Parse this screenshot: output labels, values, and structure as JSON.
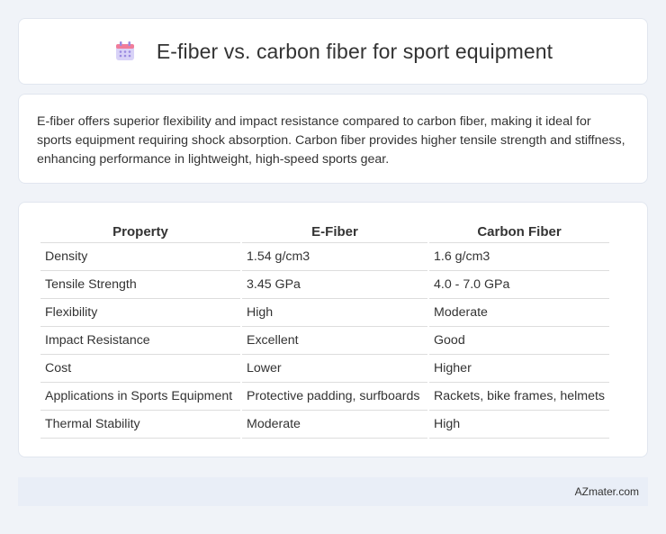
{
  "header": {
    "title": "E-fiber vs. carbon fiber for sport equipment",
    "icon": "calendar-icon",
    "icon_colors": {
      "top": "#f07c9a",
      "body": "#d8d2f7",
      "dots": "#9a8ae0"
    }
  },
  "summary": {
    "text": "E-fiber offers superior flexibility and impact resistance compared to carbon fiber, making it ideal for sports equipment requiring shock absorption. Carbon fiber provides higher tensile strength and stiffness, enhancing performance in lightweight, high-speed sports gear."
  },
  "table": {
    "headers": [
      "Property",
      "E-Fiber",
      "Carbon Fiber"
    ],
    "rows": [
      [
        "Density",
        "1.54 g/cm3",
        "1.6 g/cm3"
      ],
      [
        "Tensile Strength",
        "3.45 GPa",
        "4.0 - 7.0 GPa"
      ],
      [
        "Flexibility",
        "High",
        "Moderate"
      ],
      [
        "Impact Resistance",
        "Excellent",
        "Good"
      ],
      [
        "Cost",
        "Lower",
        "Higher"
      ],
      [
        "Applications in Sports Equipment",
        "Protective padding, surfboards",
        "Rackets, bike frames, helmets"
      ],
      [
        "Thermal Stability",
        "Moderate",
        "High"
      ]
    ]
  },
  "footer": {
    "text": "AZmater.com"
  }
}
